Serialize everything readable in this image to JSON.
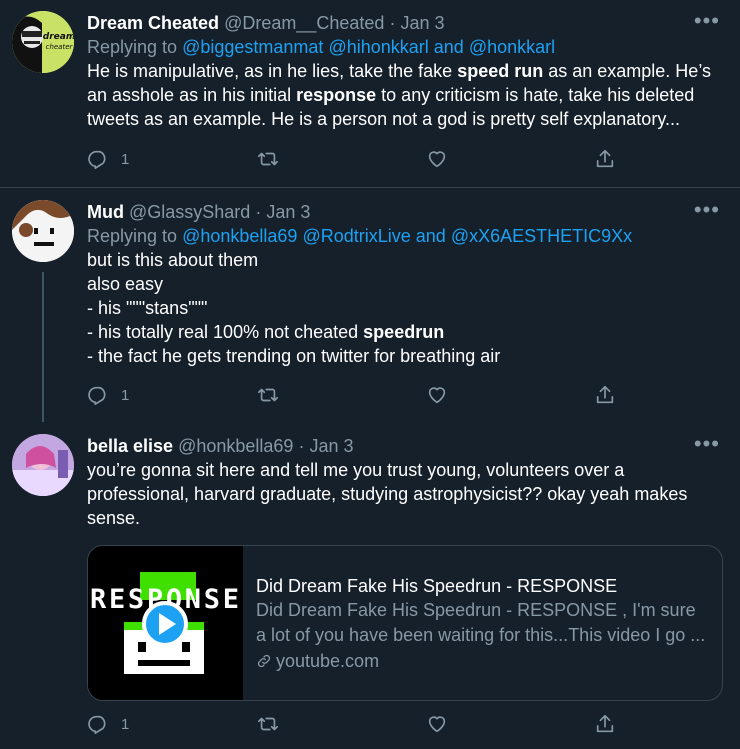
{
  "tweets": [
    {
      "name": "Dream Cheated",
      "handle": "@Dream__Cheated",
      "dot": "·",
      "date": "Jan 3",
      "replying_prefix": "Replying to",
      "replying_mentions": [
        "@biggestmanmat",
        "@hihonkkarl"
      ],
      "replying_and": "and",
      "replying_last": "@honkkarl",
      "body_parts": [
        "He is manipulative, as in he lies, take the fake ",
        "speed run",
        " as an example. He’s an asshole as in his initial ",
        "response",
        " to any criticism is hate, take his deleted tweets as an example. He is a person not a god is pretty self explanatory..."
      ],
      "reply_count": "1",
      "avatar_text": "dream cheater"
    },
    {
      "name": "Mud",
      "handle": "@GlassyShard",
      "dot": "·",
      "date": "Jan 3",
      "replying_prefix": "Replying to",
      "replying_mentions": [
        "@honkbella69",
        "@RodtrixLive"
      ],
      "replying_and": "and",
      "replying_last": "@xX6AESTHETIC9Xx",
      "lines": [
        "but is this about them",
        "also easy",
        "- his \"\"\"stans\"\"\"",
        "- his totally real 100% not cheated ",
        "speedrun",
        "- the fact he gets trending on twitter for breathing air"
      ],
      "reply_count": "1"
    },
    {
      "name": "bella elise",
      "handle": "@honkbella69",
      "dot": "·",
      "date": "Jan 3",
      "body": "you’re gonna sit here and tell me you trust young, volunteers over a professional, harvard graduate, studying astrophysicist?? okay yeah makes sense.",
      "reply_count": "1",
      "card": {
        "thumb_text": "RESPONSE",
        "title": "Did Dream Fake His Speedrun - RESPONSE",
        "description": "Did Dream Fake His Speedrun - RESPONSE , I'm sure a lot of you have been waiting for this...This video I go ...",
        "domain": "youtube.com"
      }
    }
  ],
  "icons": {
    "reply": "reply-icon",
    "retweet": "retweet-icon",
    "like": "heart-icon",
    "share": "share-icon",
    "more": "more-icon",
    "link": "link-icon",
    "play": "play-icon"
  },
  "colors": {
    "background": "#15202b",
    "accent": "#1da1f2",
    "muted": "#8899a6",
    "border": "#38444d"
  }
}
